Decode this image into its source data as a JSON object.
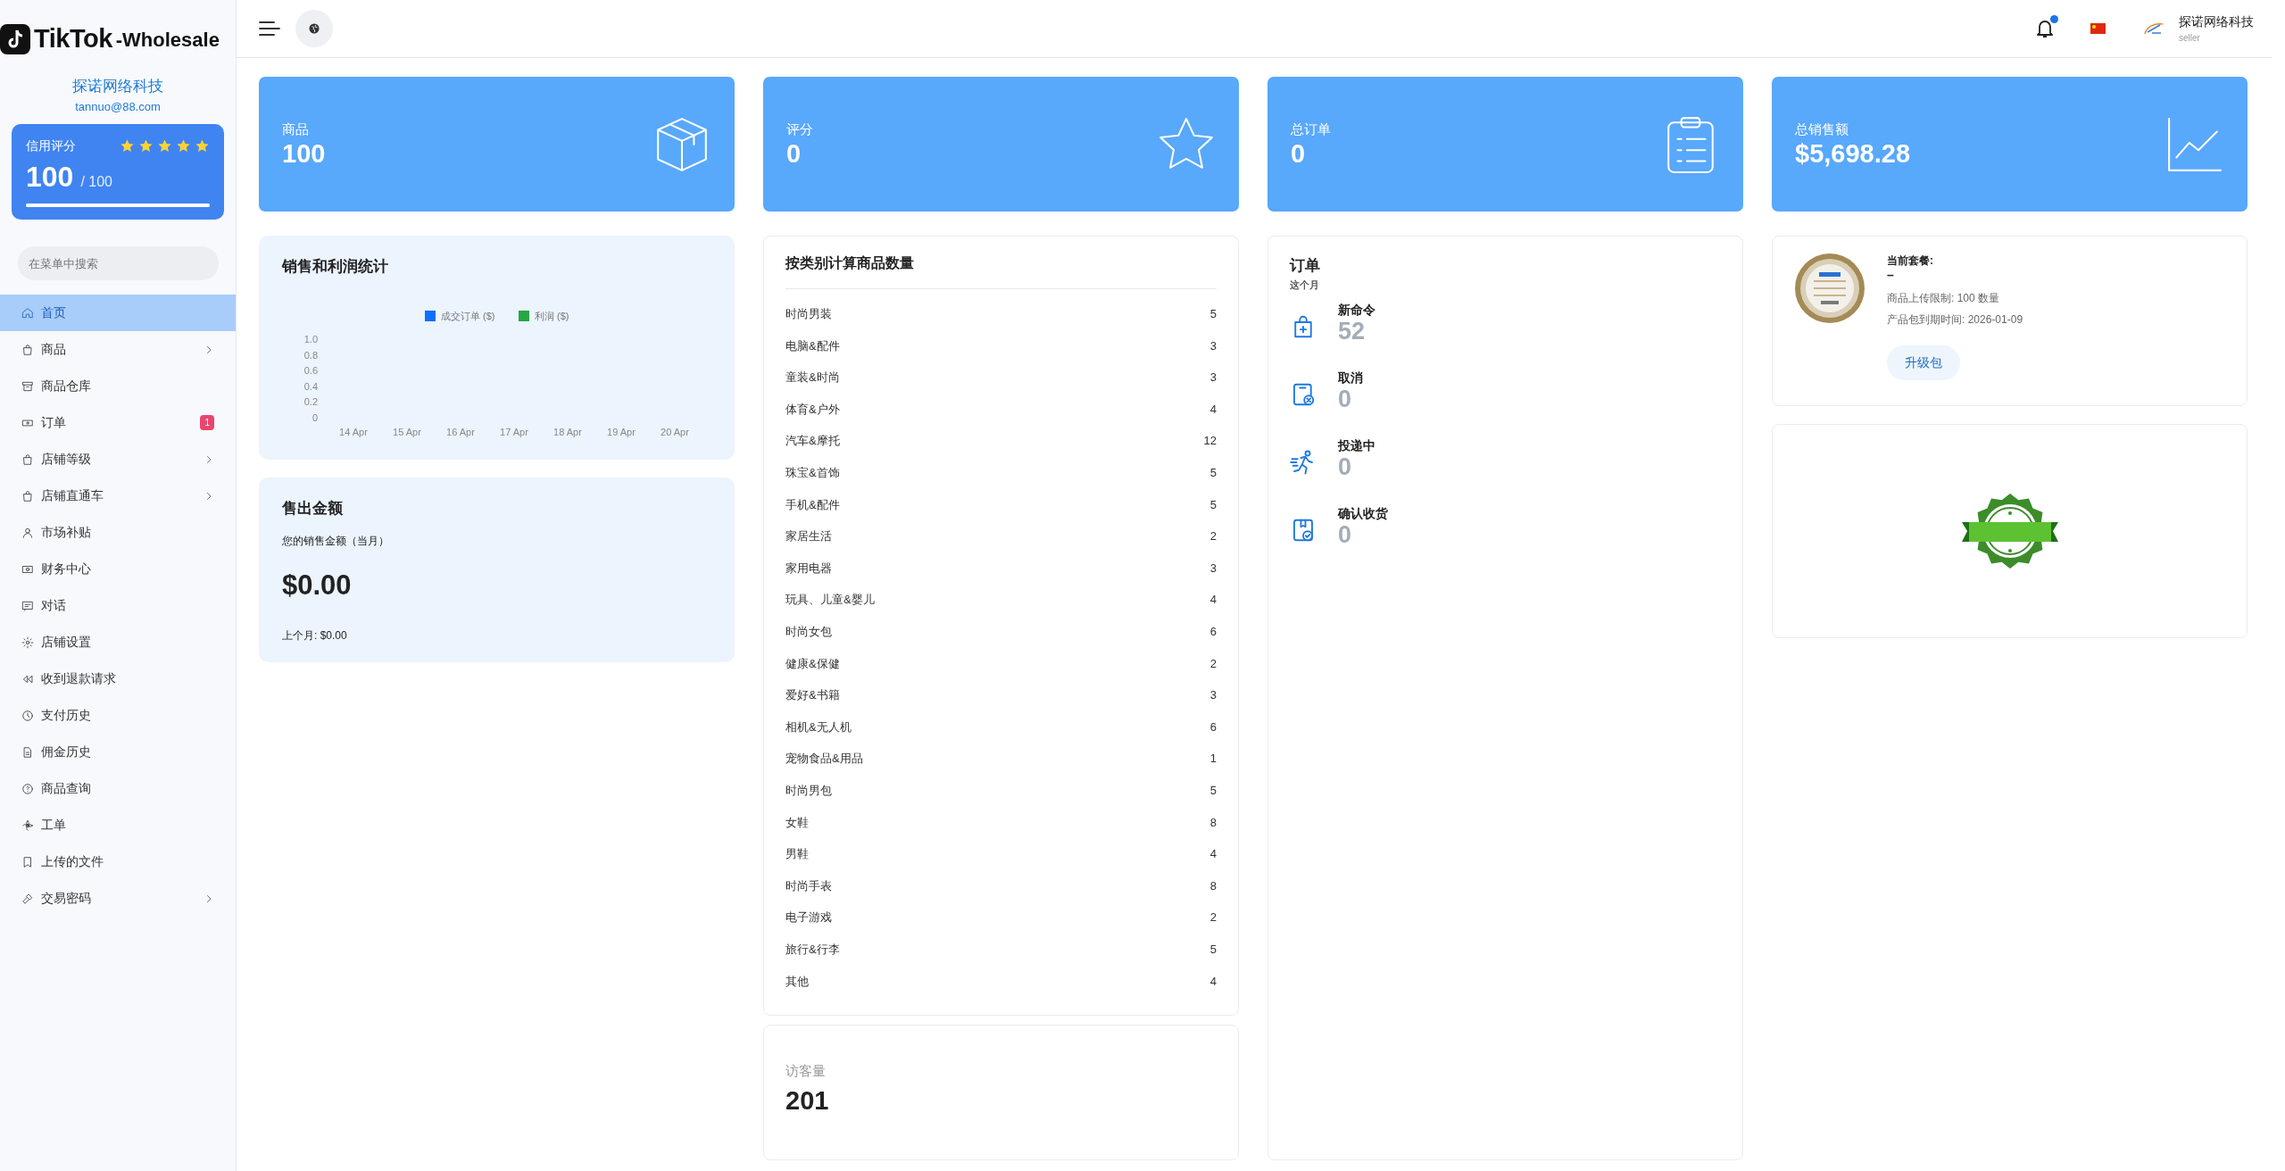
{
  "brand": {
    "logo_text": "TikTok",
    "suffix": "-Wholesale"
  },
  "shop": {
    "name": "探诺网络科技",
    "email": "tannuo@88.com"
  },
  "credit": {
    "label": "信用评分",
    "stars": 5,
    "score": "100",
    "max": "/ 100",
    "level": 1
  },
  "sidebar_search": {
    "placeholder": "在菜单中搜索"
  },
  "sidebar": {
    "items": [
      {
        "label": "首页",
        "selected": true,
        "has_submenu": false
      },
      {
        "label": "商品",
        "selected": false,
        "has_submenu": true
      },
      {
        "label": "商品仓库",
        "selected": false,
        "has_submenu": false
      },
      {
        "label": "订单",
        "selected": false,
        "has_submenu": false,
        "badge": "1"
      },
      {
        "label": "店铺等级",
        "selected": false,
        "has_submenu": true
      },
      {
        "label": "店铺直通车",
        "selected": false,
        "has_submenu": true
      },
      {
        "label": "市场补贴",
        "selected": false,
        "has_submenu": false
      },
      {
        "label": "财务中心",
        "selected": false,
        "has_submenu": false
      },
      {
        "label": "对话",
        "selected": false,
        "has_submenu": false
      },
      {
        "label": "店铺设置",
        "selected": false,
        "has_submenu": false
      },
      {
        "label": "收到退款请求",
        "selected": false,
        "has_submenu": false
      },
      {
        "label": "支付历史",
        "selected": false,
        "has_submenu": false
      },
      {
        "label": "佣金历史",
        "selected": false,
        "has_submenu": false
      },
      {
        "label": "商品查询",
        "selected": false,
        "has_submenu": false
      },
      {
        "label": "工单",
        "selected": false,
        "has_submenu": false
      },
      {
        "label": "上传的文件",
        "selected": false,
        "has_submenu": false
      },
      {
        "label": "交易密码",
        "selected": false,
        "has_submenu": true
      }
    ]
  },
  "header": {
    "user_name": "探诺网络科技",
    "user_role": "seller",
    "notification_dot": true
  },
  "stats": [
    {
      "label": "商品",
      "value": "100"
    },
    {
      "label": "评分",
      "value": "0"
    },
    {
      "label": "总订单",
      "value": "0"
    },
    {
      "label": "总销售额",
      "value": "$5,698.28"
    }
  ],
  "sales_chart": {
    "title": "销售和利润统计",
    "chart_data": {
      "type": "bar",
      "categories": [
        "14 Apr",
        "15 Apr",
        "16 Apr",
        "17 Apr",
        "18 Apr",
        "19 Apr",
        "20 Apr"
      ],
      "series": [
        {
          "name": "成交订单 ($)",
          "color": "#0d6efd",
          "values": [
            null,
            null,
            null,
            null,
            null,
            null,
            null
          ]
        },
        {
          "name": "利润 ($)",
          "color": "#28a745",
          "values": [
            null,
            null,
            null,
            null,
            null,
            null,
            null
          ]
        }
      ],
      "ylim": [
        0,
        1
      ],
      "yticks": [
        0,
        0.2,
        0.4,
        0.6,
        0.8,
        {
          "value": 1,
          "label": "1.0"
        }
      ]
    }
  },
  "sales_amount": {
    "title": "售出金额",
    "subtitle": "您的销售金额（当月）",
    "amount": "$0.00",
    "last_month": "上个月: $0.00"
  },
  "categories": {
    "title": "按类别计算商品数量",
    "rows": [
      {
        "name": "时尚男装",
        "count": "5"
      },
      {
        "name": "电脑&配件",
        "count": "3"
      },
      {
        "name": "童装&时尚",
        "count": "3"
      },
      {
        "name": "体育&户外",
        "count": "4"
      },
      {
        "name": "汽车&摩托",
        "count": "12"
      },
      {
        "name": "珠宝&首饰",
        "count": "5"
      },
      {
        "name": "手机&配件",
        "count": "5"
      },
      {
        "name": "家居生活",
        "count": "2"
      },
      {
        "name": "家用电器",
        "count": "3"
      },
      {
        "name": "玩具、儿童&婴儿",
        "count": "4"
      },
      {
        "name": "时尚女包",
        "count": "6"
      },
      {
        "name": "健康&保健",
        "count": "2"
      },
      {
        "name": "爱好&书籍",
        "count": "3"
      },
      {
        "name": "相机&无人机",
        "count": "6"
      },
      {
        "name": "宠物食品&用品",
        "count": "1"
      },
      {
        "name": "时尚男包",
        "count": "5"
      },
      {
        "name": "女鞋",
        "count": "8"
      },
      {
        "name": "男鞋",
        "count": "4"
      },
      {
        "name": "时尚手表",
        "count": "8"
      },
      {
        "name": "电子游戏",
        "count": "2"
      },
      {
        "name": "旅行&行李",
        "count": "5"
      },
      {
        "name": "其他",
        "count": "4"
      }
    ]
  },
  "visitors": {
    "label": "访客量",
    "value": "201"
  },
  "orders": {
    "title": "订单",
    "subtitle": "这个月",
    "items": [
      {
        "label": "新命令",
        "value": "52"
      },
      {
        "label": "取消",
        "value": "0"
      },
      {
        "label": "投递中",
        "value": "0"
      },
      {
        "label": "确认收货",
        "value": "0"
      }
    ]
  },
  "package": {
    "label": "当前套餐:",
    "name": "–",
    "upload_limit": "商品上传限制: 100 数量",
    "expiry": "产品包到期时间: 2026-01-09",
    "button": "升级包"
  }
}
